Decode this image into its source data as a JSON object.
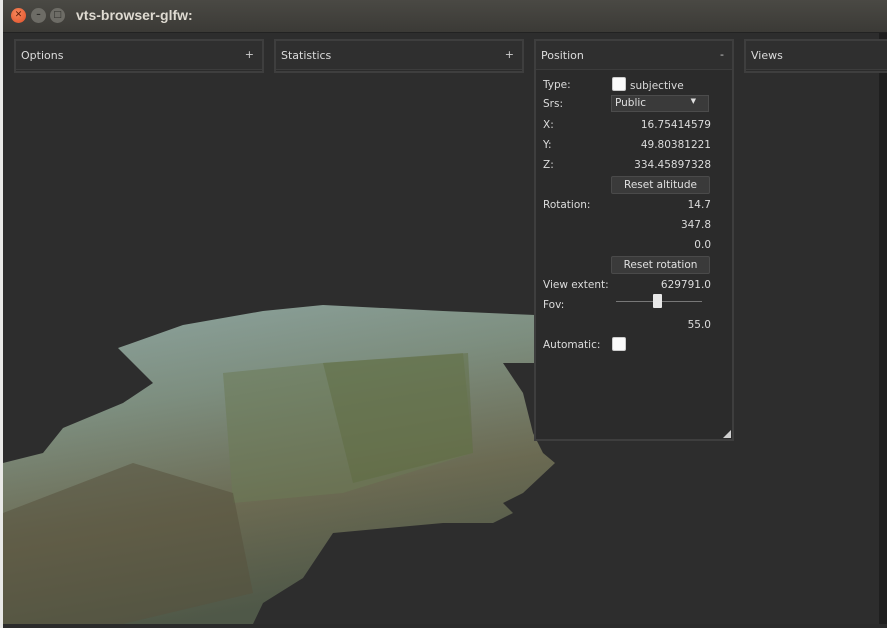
{
  "window": {
    "title": "vts-browser-glfw:"
  },
  "panels": {
    "options": {
      "title": "Options",
      "toggle": "+"
    },
    "statistics": {
      "title": "Statistics",
      "toggle": "+"
    },
    "position": {
      "title": "Position",
      "toggle": "-",
      "type_label": "Type:",
      "subjective_label": "subjective",
      "srs_label": "Srs:",
      "srs_value": "Public",
      "x_label": "X:",
      "x_value": "16.75414579",
      "y_label": "Y:",
      "y_value": "49.80381221",
      "z_label": "Z:",
      "z_value": "334.45897328",
      "reset_altitude": "Reset altitude",
      "rotation_label": "Rotation:",
      "rotation_values": [
        "14.7",
        "347.8",
        "0.0"
      ],
      "reset_rotation": "Reset rotation",
      "view_extent_label": "View extent:",
      "view_extent_value": "629791.0",
      "fov_label": "Fov:",
      "fov_value": "55.0",
      "automatic_label": "Automatic:"
    },
    "views": {
      "title": "Views"
    }
  },
  "icons": {
    "close": "close-icon",
    "minimize": "minimize-icon",
    "maximize": "maximize-icon",
    "dropdown": "chevron-down-icon"
  }
}
